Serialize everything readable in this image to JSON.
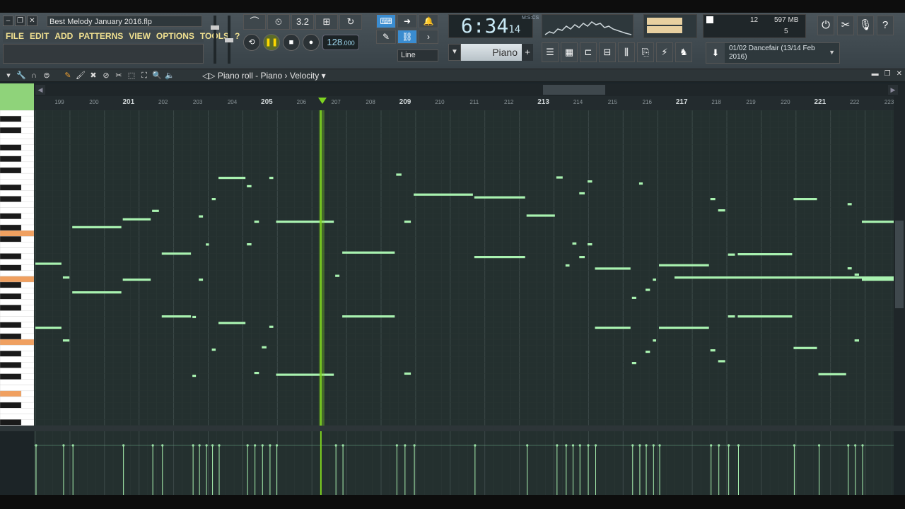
{
  "window": {
    "title": "Best Melody January 2016.flp",
    "menu": [
      "FILE",
      "EDIT",
      "ADD",
      "PATTERNS",
      "VIEW",
      "OPTIONS",
      "TOOLS",
      "?"
    ]
  },
  "transport": {
    "tempo": "128",
    "tempo_decimal": ".000",
    "time_main": "6:34",
    "time_sub": "14",
    "time_format": "M:S:CS",
    "snap_mode": "Line",
    "pattern_label": "3.2",
    "cpu": "12",
    "memory": "597 MB",
    "polyphony": "5"
  },
  "channel": {
    "name": "Piano"
  },
  "song_info": {
    "line1": "01/02  Dancefair (13/14 Feb",
    "line2": "2016)"
  },
  "piano_roll": {
    "title": "Piano roll - Piano",
    "separator": "›",
    "target": "Velocity",
    "ruler_start": 199,
    "ruler_end": 223,
    "ruler_labels": [
      "199",
      "200",
      "201",
      "202",
      "203",
      "204",
      "205",
      "206",
      "207",
      "208",
      "209",
      "210",
      "211",
      "212",
      "213",
      "214",
      "215",
      "216",
      "217",
      "218",
      "219",
      "220",
      "221",
      "222",
      "223"
    ],
    "major_bars": [
      201,
      205,
      209,
      213,
      217,
      221
    ],
    "playhead_bar": 207.3
  },
  "colors": {
    "note": "#a9f2b0",
    "playhead": "#7ed321",
    "accent_text": "#f0e090",
    "grid_bg": "#24302f"
  },
  "icons": {
    "tools": [
      "pencil-icon",
      "brush-icon",
      "delete-icon",
      "mute-icon",
      "slice-icon",
      "select-icon",
      "zoom-icon",
      "speaker-icon"
    ],
    "right": [
      "power-icon",
      "settings-icon",
      "mic-icon",
      "help-icon"
    ]
  }
}
